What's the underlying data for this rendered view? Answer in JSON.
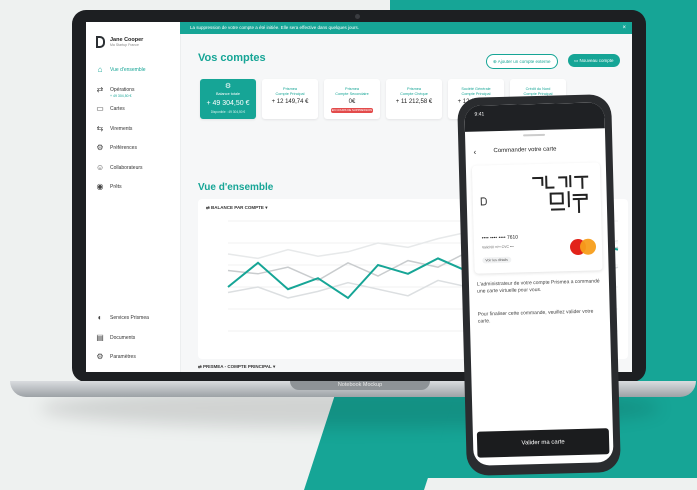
{
  "colors": {
    "accent": "#16a596",
    "danger": "#e34b4b",
    "dark": "#1b1c1e"
  },
  "laptop": {
    "brand_label": "Notebook Mockup"
  },
  "banner": {
    "text": "La suppression de votre compte a été initiée. Elle sera effective dans quelques jours.",
    "close": "×"
  },
  "user": {
    "name": "Jane Cooper",
    "company": "Ma Startup France"
  },
  "sidebar": {
    "items": [
      {
        "label": "Vue d'ensemble",
        "icon": "dashboard-icon",
        "glyph": "⌂"
      },
      {
        "label": "Opérations",
        "icon": "operations-icon",
        "glyph": "⇄"
      },
      {
        "label": "Cartes",
        "icon": "card-icon",
        "glyph": "▭"
      },
      {
        "label": "Virements",
        "icon": "transfer-icon",
        "glyph": "⇆"
      },
      {
        "label": "Préférences",
        "icon": "settings-icon",
        "glyph": "⚙"
      },
      {
        "label": "Collaborateurs",
        "icon": "users-icon",
        "glyph": "☺"
      },
      {
        "label": "Prêts",
        "icon": "loan-icon",
        "glyph": "◉"
      }
    ],
    "active_sub": "+ 49 304,50 €",
    "bottom": [
      {
        "label": "Services Prismea",
        "icon": "services-icon",
        "glyph": "◐"
      },
      {
        "label": "Documents",
        "icon": "documents-icon",
        "glyph": "▤"
      },
      {
        "label": "Paramètres",
        "icon": "gear-icon",
        "glyph": "⚙"
      }
    ]
  },
  "comptes": {
    "title": "Vos comptes",
    "btn_add": "⊕ Ajouter un compte externe",
    "btn_new": "▭ Nouveau compte",
    "accounts": [
      {
        "name": "Balance totale",
        "amount": "+ 49 304,50 €",
        "sub": "Disponible : 49 304,50 €",
        "primary": true
      },
      {
        "name": "Prismea\nCompte Principal",
        "amount": "+ 12 149,74 €"
      },
      {
        "name": "Prismea\nCompte Secondaire",
        "amount": "0€",
        "badge": "EN COURS DE SUPPRESSION"
      },
      {
        "name": "Prismea\nCompte Chèque",
        "amount": "+ 11 212,58 €"
      },
      {
        "name": "Société Générale\nCompte Principal",
        "amount": "+ 12 141,45 €"
      },
      {
        "name": "Crédit du Nord\nCompte Principal",
        "amount": "+ 1"
      }
    ]
  },
  "overview": {
    "title": "Vue d'ensemble",
    "chart_label": "⇄ BALANCE PAR COMPTE ▾",
    "chart2_label": "⇄ PRISMEA - COMPTE PRINCIPAL ▾"
  },
  "chart_data": {
    "type": "line",
    "ylim": [
      0,
      100
    ],
    "grid": true,
    "series": [
      {
        "color": "#16a596",
        "values": [
          40,
          62,
          38,
          48,
          30,
          60,
          52,
          66,
          54,
          42,
          68,
          66,
          80,
          74
        ]
      },
      {
        "color": "#c9ccce",
        "values": [
          55,
          52,
          58,
          46,
          62,
          50,
          64,
          58,
          72,
          78,
          66,
          74,
          70,
          76
        ]
      },
      {
        "color": "#dcdfe1",
        "values": [
          35,
          40,
          30,
          36,
          44,
          38,
          32,
          46,
          40,
          52,
          48,
          56,
          50,
          58
        ]
      },
      {
        "color": "#e7e9ea",
        "values": [
          70,
          66,
          74,
          68,
          72,
          80,
          76,
          84,
          90,
          86,
          80,
          84,
          78,
          82
        ]
      }
    ]
  },
  "phone": {
    "status_time": "9:41",
    "title": "Commander votre carte",
    "card_number": "•••• •••• •••• 7610",
    "card_valid": "Valid till ••/••      CVC •••",
    "card_see": "Voir les détails",
    "text1": "L'administrateur de votre compte Prismea a commandé une carte virtuelle pour vous.",
    "text2": "Pour finaliser cette commande, veuillez valider votre carte.",
    "button": "Valider ma carte"
  }
}
